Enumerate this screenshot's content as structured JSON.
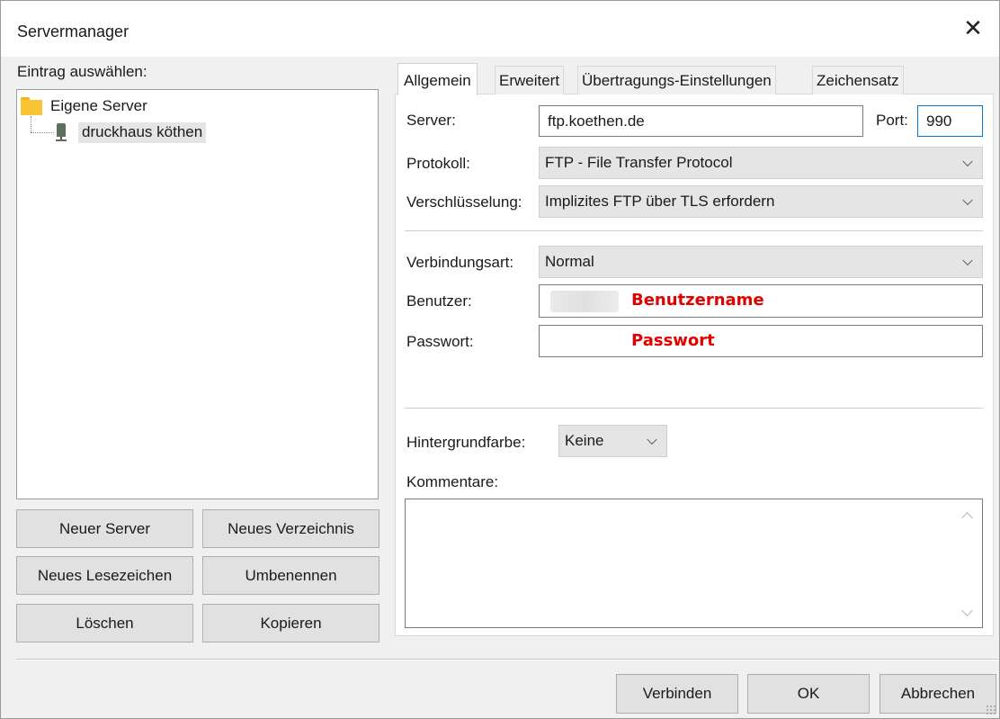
{
  "window": {
    "title": "Servermanager",
    "close_glyph": "✕"
  },
  "tree": {
    "label": "Eintrag auswählen:",
    "root": {
      "label": "Eigene Server",
      "icon": "folder-icon"
    },
    "child": {
      "label": "druckhaus köthen",
      "icon": "server-icon"
    }
  },
  "left_buttons": {
    "new_server": "Neuer Server",
    "new_folder": "Neues Verzeichnis",
    "new_bookmark": "Neues Lesezeichen",
    "rename": "Umbenennen",
    "delete": "Löschen",
    "copy": "Kopieren"
  },
  "tabs": [
    {
      "label": "Allgemein",
      "active": true
    },
    {
      "label": "Erweitert",
      "active": false
    },
    {
      "label": "Übertragungs-Einstellungen",
      "active": false
    },
    {
      "label": "Zeichensatz",
      "active": false
    }
  ],
  "form": {
    "server_label": "Server:",
    "server_value": "ftp.koethen.de",
    "port_label": "Port:",
    "port_value": "990",
    "protocol_label": "Protokoll:",
    "protocol_value": "FTP - File Transfer Protocol",
    "encryption_label": "Verschlüsselung:",
    "encryption_value": "Implizites FTP über TLS erfordern",
    "logon_label": "Verbindungsart:",
    "logon_value": "Normal",
    "user_label": "Benutzer:",
    "user_annotation": "Benutzername",
    "password_label": "Passwort:",
    "password_annotation": "Passwort",
    "bgcolor_label": "Hintergrundfarbe:",
    "bgcolor_value": "Keine",
    "comments_label": "Kommentare:"
  },
  "footer": {
    "connect": "Verbinden",
    "ok": "OK",
    "cancel": "Abbrechen"
  },
  "colors": {
    "annotation": "#e00000",
    "focus_border": "#0078d7",
    "folder": "#f8c335"
  }
}
